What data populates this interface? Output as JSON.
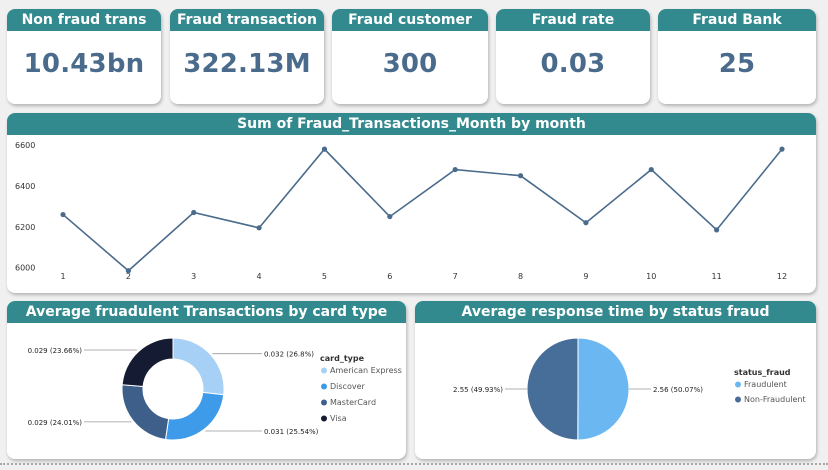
{
  "kpis": [
    {
      "title": "Non fraud trans",
      "value": "10.43bn"
    },
    {
      "title": "Fraud transaction",
      "value": "322.13M"
    },
    {
      "title": "Fraud customer",
      "value": "300"
    },
    {
      "title": "Fraud rate",
      "value": "0.03"
    },
    {
      "title": "Fraud Bank",
      "value": "25"
    }
  ],
  "line_chart": {
    "title": "Sum of Fraud_Transactions_Month by month"
  },
  "donut_chart": {
    "title": "Average fruadulent Transactions by card type",
    "legend_title": "card_type"
  },
  "pie_chart": {
    "title": "Average response time by status fraud",
    "legend_title": "status_fraud"
  },
  "colors": {
    "header": "#338a8e",
    "kpi_value": "#4a6b8c",
    "line": "#4a6b8c",
    "american_express": "#a6d0f5",
    "discover": "#3d9be9",
    "mastercard": "#3e5f8a",
    "visa": "#141b33",
    "fraudulent": "#6ab7f2",
    "non_fraudulent": "#476d99"
  },
  "chart_data": [
    {
      "type": "line",
      "title": "Sum of Fraud_Transactions_Month by month",
      "x": [
        1,
        2,
        3,
        4,
        5,
        6,
        7,
        8,
        9,
        10,
        11,
        12
      ],
      "y": [
        6260,
        5985,
        6270,
        6195,
        6580,
        6250,
        6480,
        6450,
        6220,
        6480,
        6185,
        6580
      ],
      "ylim": [
        5930,
        6610
      ],
      "yticks": [
        6000,
        6200,
        6400,
        6600
      ],
      "grid": false
    },
    {
      "type": "pie",
      "title": "Average fruadulent Transactions by card type",
      "legend_title": "card_type",
      "labels": [
        "American Express",
        "Discover",
        "MasterCard",
        "Visa"
      ],
      "values": [
        0.032,
        0.031,
        0.029,
        0.029
      ],
      "percent": [
        26.8,
        25.54,
        24.01,
        23.66
      ],
      "data_labels": [
        "0.032 (26.8%)",
        "0.031 (25.54%)",
        "0.029 (24.01%)",
        "0.029 (23.66%)"
      ],
      "colors": [
        "#a6d0f5",
        "#3d9be9",
        "#3e5f8a",
        "#141b33"
      ],
      "donut": true,
      "legend_position": "right"
    },
    {
      "type": "pie",
      "title": "Average response time by status fraud",
      "legend_title": "status_fraud",
      "labels": [
        "Fraudulent",
        "Non-Fraudulent"
      ],
      "values": [
        2.56,
        2.55
      ],
      "percent": [
        50.07,
        49.93
      ],
      "data_labels": [
        "2.56 (50.07%)",
        "2.55 (49.93%)"
      ],
      "colors": [
        "#6ab7f2",
        "#476d99"
      ],
      "donut": false,
      "legend_position": "right"
    }
  ]
}
